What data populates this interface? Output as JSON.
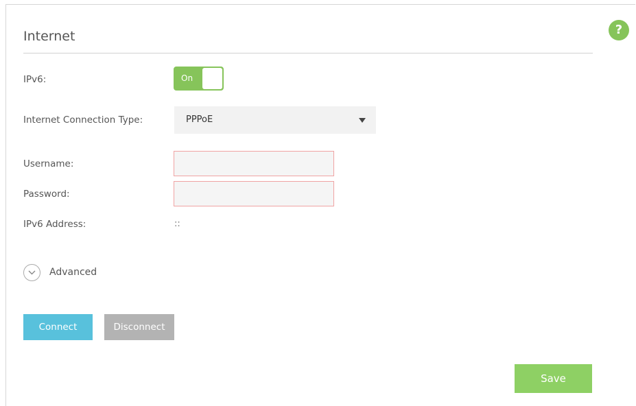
{
  "help": {
    "label": "?"
  },
  "section": {
    "title": "Internet"
  },
  "ipv6": {
    "label": "IPv6:",
    "toggle_text": "On",
    "enabled": true
  },
  "connection_type": {
    "label": "Internet Connection Type:",
    "value": "PPPoE"
  },
  "username": {
    "label": "Username:",
    "value": "",
    "placeholder": ""
  },
  "password": {
    "label": "Password:",
    "value": "",
    "placeholder": ""
  },
  "ipv6_address": {
    "label": "IPv6 Address:",
    "value": "::"
  },
  "advanced": {
    "label": "Advanced"
  },
  "buttons": {
    "connect": "Connect",
    "disconnect": "Disconnect",
    "save": "Save"
  },
  "colors": {
    "accent_green": "#86c45a",
    "connect_blue": "#58c1dc",
    "disabled_gray": "#b3b3b3",
    "error_border": "#f0a3a3"
  },
  "icons": {
    "help": "question-circle-icon",
    "dropdown": "caret-down-icon",
    "advanced": "chevron-down-circle-icon"
  }
}
